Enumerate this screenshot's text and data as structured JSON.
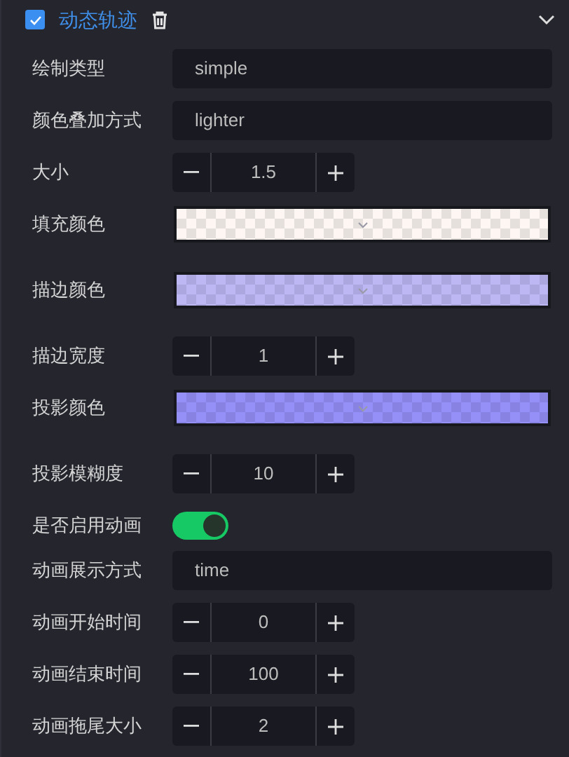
{
  "section": {
    "title": "动态轨迹",
    "enabled": true,
    "expanded": true
  },
  "rows": [
    {
      "kind": "text",
      "label": "绘制类型",
      "value": "simple"
    },
    {
      "kind": "text",
      "label": "颜色叠加方式",
      "value": "lighter"
    },
    {
      "kind": "stepper",
      "label": "大小",
      "value": "1.5"
    },
    {
      "kind": "color",
      "label": "填充颜色",
      "color": "#fdf6f3"
    },
    {
      "kind": "color",
      "label": "描边颜色",
      "color": "#bdb8f4"
    },
    {
      "kind": "stepper",
      "label": "描边宽度",
      "value": "1"
    },
    {
      "kind": "color",
      "label": "投影颜色",
      "color": "#9590f8"
    },
    {
      "kind": "stepper",
      "label": "投影模糊度",
      "value": "10"
    },
    {
      "kind": "switch",
      "label": "是否启用动画",
      "on": true
    },
    {
      "kind": "text",
      "label": "动画展示方式",
      "value": "time"
    },
    {
      "kind": "stepper",
      "label": "动画开始时间",
      "value": "0"
    },
    {
      "kind": "stepper",
      "label": "动画结束时间",
      "value": "100"
    },
    {
      "kind": "stepper",
      "label": "动画拖尾大小",
      "value": "2"
    }
  ]
}
